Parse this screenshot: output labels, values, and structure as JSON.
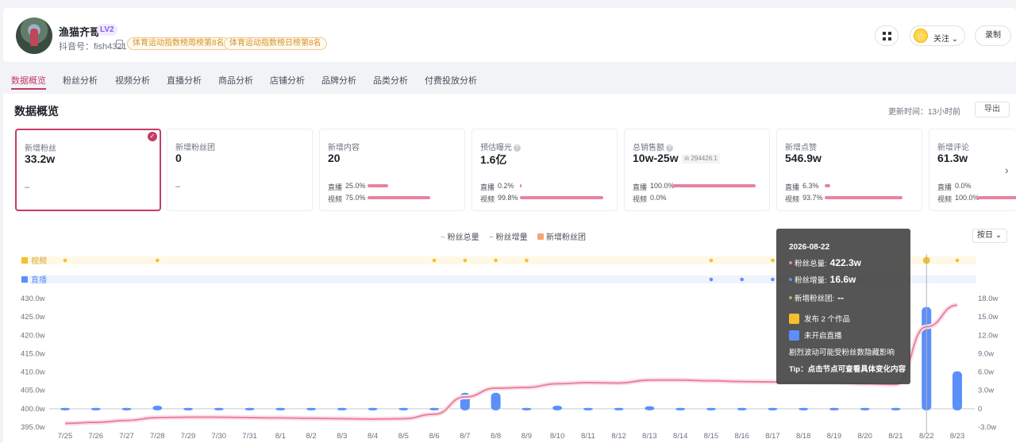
{
  "profile": {
    "name": "渔猫齐哥",
    "level": "LV2",
    "douyin_id": "抖音号：fish4321",
    "badges": [
      "体育运动指数榜周榜第8名",
      "体育运动指数榜日榜第8名"
    ],
    "follow_label": "关注",
    "record_label": "录制"
  },
  "tabs": [
    "数据概览",
    "粉丝分析",
    "视频分析",
    "直播分析",
    "商品分析",
    "店铺分析",
    "品牌分析",
    "品类分析",
    "付费投放分析"
  ],
  "overview": {
    "title": "数据概览",
    "update_time": "更新时间：13小时前",
    "export_label": "导出"
  },
  "metrics": [
    {
      "label": "新增粉丝",
      "value": "33.2w",
      "dash": "–"
    },
    {
      "label": "新增粉丝团",
      "value": "0",
      "dash": "–"
    },
    {
      "label": "新增内容",
      "value": "20",
      "rows": [
        {
          "name": "直播",
          "pct": "25.0%",
          "frac": 0.25
        },
        {
          "name": "视频",
          "pct": "75.0%",
          "frac": 0.75
        }
      ]
    },
    {
      "label": "预估曝光",
      "value": "1.6亿",
      "rows": [
        {
          "name": "直播",
          "pct": "0.2%",
          "frac": 0.002
        },
        {
          "name": "视频",
          "pct": "99.8%",
          "frac": 0.998
        }
      ]
    },
    {
      "label": "总销售额",
      "value": "10w-25w",
      "badge": "294426.1",
      "rows": [
        {
          "name": "直播",
          "pct": "100.0%",
          "frac": 1.0
        },
        {
          "name": "视频",
          "pct": "0.0%",
          "frac": 0
        }
      ]
    },
    {
      "label": "新增点赞",
      "value": "546.9w",
      "rows": [
        {
          "name": "直播",
          "pct": "6.3%",
          "frac": 0.063
        },
        {
          "name": "视频",
          "pct": "93.7%",
          "frac": 0.937
        }
      ]
    },
    {
      "label": "新增评论",
      "value": "61.3w",
      "rows": [
        {
          "name": "直播",
          "pct": "0.0%",
          "frac": 0
        },
        {
          "name": "视频",
          "pct": "100.0%",
          "frac": 1.0
        }
      ]
    }
  ],
  "legend": [
    "粉丝总量",
    "粉丝增量",
    "新增粉丝团"
  ],
  "by_day_label": "按日",
  "tooltip": {
    "date": "2026-08-22",
    "total_label": "粉丝总量:",
    "total_value": "422.3w",
    "incr_label": "粉丝增量:",
    "incr_value": "16.6w",
    "club_label": "新增粉丝团:",
    "club_value": "--",
    "video_text": "发布 2 个作品",
    "live_text": "未开启直播",
    "note": "剧烈波动可能受粉丝数隐藏影响",
    "tip": "Tip：点击节点可查看具体变化内容"
  },
  "chart_data": {
    "type": "line",
    "categories": [
      "7/25",
      "7/26",
      "7/27",
      "7/28",
      "7/29",
      "7/30",
      "7/31",
      "8/1",
      "8/2",
      "8/3",
      "8/4",
      "8/5",
      "8/6",
      "8/7",
      "8/8",
      "8/9",
      "8/10",
      "8/11",
      "8/12",
      "8/13",
      "8/14",
      "8/15",
      "8/16",
      "8/17",
      "8/18",
      "8/19",
      "8/20",
      "8/21",
      "8/22",
      "8/23"
    ],
    "row_labels": {
      "video": "视频",
      "live": "直播"
    },
    "video_days": [
      "7/25",
      "7/28",
      "8/6",
      "8/7",
      "8/8",
      "8/9",
      "8/15",
      "8/17",
      "8/22",
      "8/23"
    ],
    "live_days": [
      "8/15",
      "8/16",
      "8/17"
    ],
    "left_axis": {
      "ticks": [
        "395.0w",
        "400.0w",
        "405.0w",
        "410.0w",
        "415.0w",
        "420.0w",
        "425.0w",
        "430.0w"
      ],
      "range": [
        395,
        430
      ]
    },
    "right_axis": {
      "ticks": [
        "-3.0w",
        "0",
        "3.0w",
        "6.0w",
        "9.0w",
        "12.0w",
        "15.0w",
        "18.0w"
      ],
      "range": [
        -3,
        18
      ]
    },
    "series": [
      {
        "name": "粉丝总量",
        "axis": "left",
        "color": "#e8839d",
        "values": [
          396.0,
          396.3,
          396.8,
          397.6,
          397.7,
          397.7,
          397.6,
          397.5,
          397.4,
          397.3,
          397.2,
          397.3,
          398.5,
          403.2,
          405.6,
          405.8,
          406.8,
          407.1,
          407.0,
          407.8,
          407.8,
          407.6,
          407.4,
          407.3,
          407.3,
          407.2,
          406.8,
          406.6,
          422.3,
          428.2
        ]
      },
      {
        "name": "粉丝增量",
        "axis": "right",
        "color": "#5b8ff9",
        "values": [
          0.1,
          0.1,
          0.0,
          0.5,
          0.0,
          0.0,
          0.0,
          0.0,
          0.0,
          0.0,
          0.0,
          0.0,
          0.0,
          2.6,
          2.6,
          0.0,
          0.5,
          0.0,
          0.1,
          0.4,
          0.0,
          0.0,
          0.0,
          0.0,
          0.0,
          0.0,
          0.0,
          0.0,
          16.6,
          6.1
        ]
      },
      {
        "name": "新增粉丝团",
        "axis": "right",
        "color": "#f4a872",
        "values": []
      }
    ],
    "highlight_index": 28
  },
  "colors": {
    "accent": "#c63c63",
    "line": "#e8839d",
    "bar": "#5b8ff9",
    "video_dot": "#f5c02b"
  }
}
